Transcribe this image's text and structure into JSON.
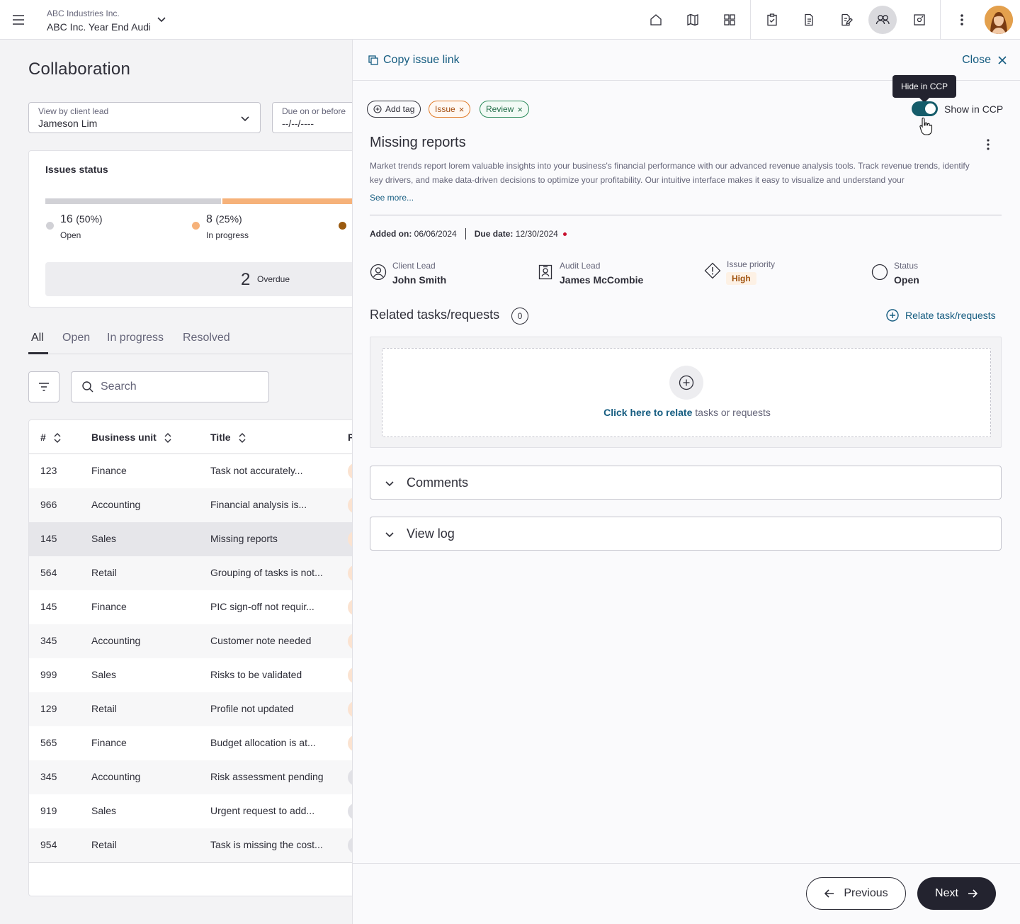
{
  "header": {
    "org_name": "ABC Industries Inc.",
    "engagement_name": "ABC Inc. Year  End Audit",
    "nav_icons": [
      "home-icon",
      "map-icon",
      "dashboard-icon",
      "clipboard-check-icon",
      "document-icon",
      "document-edit-icon",
      "collaboration-icon",
      "settings-icon",
      "more-icon"
    ],
    "active_nav": "collaboration-icon"
  },
  "page": {
    "title": "Collaboration",
    "filters": {
      "client_lead_label": "View by client lead",
      "client_lead_value": "Jameson Lim",
      "due_label": "Due on or before",
      "due_value": "--/--/----"
    },
    "issues_status": {
      "title": "Issues status",
      "open_count": "16",
      "open_pct": "(50%)",
      "open_label": "Open",
      "progress_count": "8",
      "progress_pct": "(25%)",
      "progress_label": "In progress",
      "overdue_count": "2",
      "overdue_label": "Overdue",
      "colors": {
        "open": "#d1d1d6",
        "in_progress": "#f6b27a",
        "resolved": "#9a5a10"
      }
    },
    "tabs": [
      "All",
      "Open",
      "In progress",
      "Resolved"
    ],
    "active_tab": "All",
    "search_placeholder": "Search",
    "table": {
      "headers": {
        "num": "#",
        "unit": "Business unit",
        "title": "Title",
        "p": "P"
      },
      "rows": [
        {
          "num": "123",
          "unit": "Finance",
          "title": "Task not accurately..."
        },
        {
          "num": "966",
          "unit": "Accounting",
          "title": "Financial analysis is..."
        },
        {
          "num": "145",
          "unit": "Sales",
          "title": "Missing reports"
        },
        {
          "num": "564",
          "unit": "Retail",
          "title": "Grouping of tasks is not..."
        },
        {
          "num": "145",
          "unit": "Finance",
          "title": "PIC sign-off not requir..."
        },
        {
          "num": "345",
          "unit": "Accounting",
          "title": "Customer note needed"
        },
        {
          "num": "999",
          "unit": "Sales",
          "title": "Risks to be validated"
        },
        {
          "num": "129",
          "unit": "Retail",
          "title": "Profile not updated"
        },
        {
          "num": "565",
          "unit": "Finance",
          "title": "Budget allocation is at..."
        },
        {
          "num": "345",
          "unit": "Accounting",
          "title": "Risk assessment pending"
        },
        {
          "num": "919",
          "unit": "Sales",
          "title": "Urgent request to add..."
        },
        {
          "num": "954",
          "unit": "Retail",
          "title": "Task is missing the cost..."
        }
      ]
    }
  },
  "panel": {
    "copy_link": "Copy issue link",
    "close": "Close",
    "add_tag": "Add tag",
    "tags": [
      "Issue",
      "Review"
    ],
    "toggle_label": "Show in CCP",
    "tooltip": "Hide in CCP",
    "issue_title": "Missing reports",
    "description": "Market trends report lorem valuable insights into your business's financial performance with our advanced revenue analysis tools. Track revenue trends, identify key drivers, and make data-driven decisions to optimize your profitability. Our intuitive interface makes it easy to visualize and understand your",
    "see_more": "See more...",
    "added_on_label": "Added on:",
    "added_on": "06/06/2024",
    "due_date_label": "Due date:",
    "due_date": "12/30/2024",
    "client_lead_label": "Client Lead",
    "client_lead": "John Smith",
    "audit_lead_label": "Audit Lead",
    "audit_lead": "James McCombie",
    "priority_label": "Issue priority",
    "priority": "High",
    "status_label": "Status",
    "status": "Open",
    "related_title": "Related tasks/requests",
    "related_count": "0",
    "relate_link": "Relate task/requests",
    "relate_cta_link": "Click here to relate",
    "relate_cta_rest": " tasks or requests",
    "comments": "Comments",
    "view_log": "View log",
    "previous": "Previous",
    "next": "Next",
    "accent": "#155c80"
  }
}
